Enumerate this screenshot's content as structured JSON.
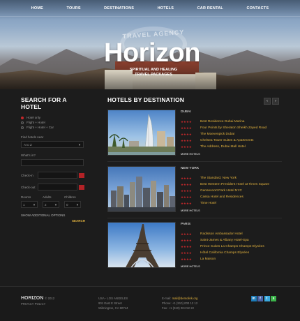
{
  "nav": {
    "items": [
      "HOME",
      "TOURS",
      "DESTINATIONS",
      "HOTELS",
      "CAR RENTAL",
      "CONTACTS"
    ]
  },
  "brand": {
    "arc_text": "TRAVEL AGENCY",
    "name": "Horizon",
    "tagline_1": "SPIRITUAL AND HEALING",
    "tagline_2": "TRAVEL PACKAGES"
  },
  "search": {
    "title": "SEARCH FOR A HOTEL",
    "options": [
      "Hotel only",
      "Flight + Hotel",
      "Flight + Hotel + Car"
    ],
    "selected_option": "Hotel only",
    "find_label": "Find hotels near",
    "find_value": "A to Z",
    "what_label": "What's in?",
    "checkin_label": "Check-in",
    "checkout_label": "Check-out",
    "rooms_label": "Rooms",
    "adults_label": "Adults",
    "children_label": "Children",
    "rooms_value": "1",
    "adults_value": "2",
    "children_value": "0",
    "additional": "SHOW ADDITIONAL OPTIONS",
    "submit": "SEARCH"
  },
  "hotels": {
    "title": "HOTELS BY DESTINATION",
    "prev": "‹",
    "next": "›",
    "more_label": "MORE HOTELS",
    "destinations": [
      {
        "city": "DUBAI",
        "items": [
          "Best Residence Dubai Marina",
          "Four Points by Sheraton Sheikh Zayed Road",
          "The Moevenpick Dubai",
          "Chelsea Tower Suites & Apartments",
          "The Address, Dubai Mall Hotel"
        ]
      },
      {
        "city": "NEW YORK",
        "items": [
          "The Standard, New York",
          "Best Western President Hotel at Times Square",
          "Gansevoort Park Hotel NYC",
          "Cassa Hotel and Residences",
          "Time Hotel"
        ]
      },
      {
        "city": "PARIS",
        "items": [
          "Radisson Ambassador Hotel",
          "Saint-James & Albany Hotel-Spa",
          "Prince Suites La Champs Champs-Elysées",
          "Hôtel California Champs Elysées",
          "La Maison"
        ]
      }
    ],
    "stars": "★★★★"
  },
  "footer": {
    "brand": "HORIZON",
    "copyright": "© 2012",
    "privacy": "PRIVACY POLICY",
    "addr_1": "USA - LOS ANGELES",
    "addr_2": "901 East E Street",
    "addr_3": "Wilmington, CA 90744",
    "email_label": "E-mail:",
    "email": "mail@demolink.org",
    "phone": "Phone: +1 (910) 000 12 12",
    "fax": "Fax: +1 (910) 004 52 22",
    "social": [
      "in",
      "f",
      "t",
      "s"
    ]
  },
  "colors": {
    "accent_red": "#c4282b",
    "accent_gold": "#e3b33e",
    "linkedin": "#1c7bb8",
    "facebook": "#4a63a6",
    "twitter": "#3aa9dd",
    "skype": "#3bb34a"
  }
}
